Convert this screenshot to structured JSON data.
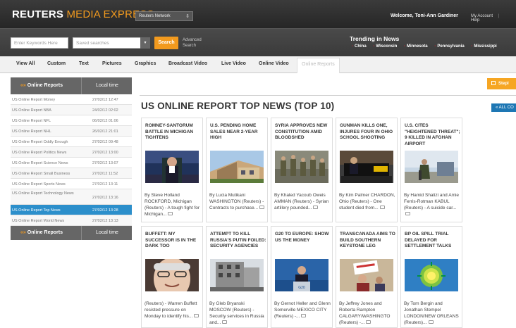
{
  "header": {
    "logo_main": "REUTERS ",
    "logo_accent": "MEDIA EXPRESS",
    "network": "Reuters Network",
    "welcome": "Welcome, Toni-Ann Gardiner",
    "my_account": "My Account",
    "separator": "|",
    "help": "Help"
  },
  "search": {
    "keywords_placeholder": "Enter Keywords Here",
    "saved_placeholder": "Saved searches",
    "button": "Search",
    "advanced_line1": "Advanced",
    "advanced_line2": "Search"
  },
  "trending": {
    "title": "Trending in News",
    "items": [
      "China",
      "Wisconsin",
      "Minnesota",
      "Pennsylvania",
      "Mississippi"
    ]
  },
  "tabs": [
    "View All",
    "Custom",
    "Text",
    "Pictures",
    "Graphics",
    "Broadcast Video",
    "Live Video",
    "Online Video",
    "Online Reports"
  ],
  "sidebar": {
    "head_label": "Online Reports",
    "head_arrows": "«»",
    "time_label": "Local time",
    "rows": [
      {
        "name": "US Online Report Money",
        "time": "27/02/12 12:47"
      },
      {
        "name": "US Online Report NBA",
        "time": "24/02/12 02:02"
      },
      {
        "name": "US Online Report NFL",
        "time": "06/02/12 01:06"
      },
      {
        "name": "US Online Report NHL",
        "time": "26/02/12 21:01"
      },
      {
        "name": "US Online Report Oddly Enough",
        "time": "27/02/12 09:48"
      },
      {
        "name": "US Online Report Politics News",
        "time": "27/02/12 13:00"
      },
      {
        "name": "US Online Report Science News",
        "time": "27/02/12 13:07"
      },
      {
        "name": "US Online Report Small Business",
        "time": "27/02/12 11:52"
      },
      {
        "name": "US Online Report Sports News",
        "time": "27/02/12 13:11"
      },
      {
        "name": "US Online Report Technology News",
        "time": "27/02/12 13:16"
      },
      {
        "name": "US Online Report Top News",
        "time": "27/02/12 13:28"
      },
      {
        "name": "US Online Report World News",
        "time": "27/02/12 13:13"
      }
    ]
  },
  "main": {
    "title": "US ONLINE REPORT TOP NEWS (TOP 10)",
    "orange_button": "Stepl",
    "all_button": "« ALL CO",
    "cards": [
      {
        "headline": "ROMNEY-SANTORUM BATTLE IN MICHIGAN TIGHTENS",
        "body": "By Steve Holland ROCKFORD, Michigan (Reuters) - A tough fight for Michigan..."
      },
      {
        "headline": "U.S. PENDING HOME SALES NEAR 2-YEAR HIGH",
        "body": "By Lucia Mutikani WASHINGTON (Reuters) - Contracts to purchase..."
      },
      {
        "headline": "SYRIA APPROVES NEW CONSTITUTION AMID BLOODSHED",
        "body": "By Khaled Yacoub Oweis AMMAN (Reuters) - Syrian artillery pounded..."
      },
      {
        "headline": "GUNMAN KILLS ONE, INJURES FOUR IN OHIO SCHOOL SHOOTING",
        "body": "By Kim Palmer CHARDON, Ohio (Reuters) - One student died from..."
      },
      {
        "headline": "U.S. CITES \"HEIGHTENED THREAT\"; 9 KILLED IN AFGHAN AIRPORT",
        "body": "By Hamid Shalizi and Amie Ferris-Rotman KABUL (Reuters) - A suicide car..."
      },
      {
        "headline": "BUFFETT: MY SUCCESSOR IS IN THE DARK TOO",
        "body": "(Reuters) - Warren Buffett resisted pressure on Monday to identify his..."
      },
      {
        "headline": "ATTEMPT TO KILL RUSSIA'S PUTIN FOILED: SECURITY AGENCIES",
        "body": "By Gleb Bryanski MOSCOW (Reuters) - Security services in Russia and..."
      },
      {
        "headline": "G20 TO EUROPE: SHOW US THE MONEY",
        "body": "By Gernot Heller and Glenn Somerville MEXICO CITY (Reuters) -..."
      },
      {
        "headline": "TRANSCANADA AIMS TO BUILD SOUTHERN KEYSTONE LEG",
        "body": "By Jeffrey Jones and Roberta Rampton CALGARY/WASHINGTO (Reuters) -..."
      },
      {
        "headline": "BP OIL SPILL TRIAL DELAYED FOR SETTLEMENT TALKS",
        "body": "By Tom Bergin and Jonathan Stempel LONDON/NEW ORLEANS (Reuters)..."
      }
    ]
  }
}
